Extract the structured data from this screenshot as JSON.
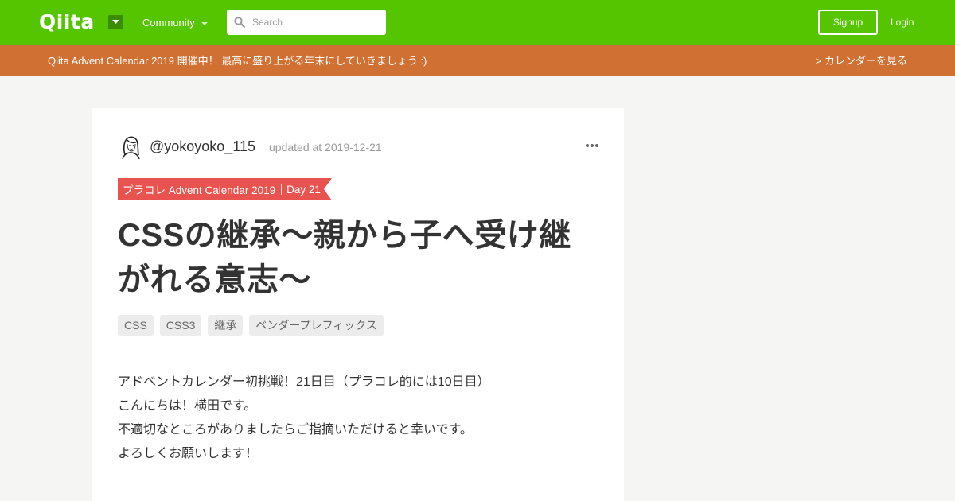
{
  "header": {
    "logo_text": "Qiita",
    "community_label": "Community",
    "search_placeholder": "Search",
    "signup_label": "Signup",
    "login_label": "Login",
    "brand_color": "#55c500"
  },
  "banner": {
    "text": "Qiita Advent Calendar 2019 開催中！ 最高に盛り上がる年末にしていきましょう :)",
    "link_label": "> カレンダーを見る",
    "color": "#d07133"
  },
  "article": {
    "author": "@yokoyoko_115",
    "updated": "updated at 2019-12-21",
    "calendar_name": "プラコレ Advent Calendar 2019",
    "calendar_day": "Day 21",
    "title": "CSSの継承〜親から子へ受け継がれる意志〜",
    "tags": [
      "CSS",
      "CSS3",
      "継承",
      "ベンダープレフィックス"
    ],
    "body_lines": [
      "アドベントカレンダー初挑戦！21日目（プラコレ的には10日目）",
      "こんにちは！横田です。",
      "不適切なところがありましたらご指摘いただけると幸いです。",
      "よろしくお願いします！"
    ],
    "ribbon_color": "#e9534f"
  }
}
